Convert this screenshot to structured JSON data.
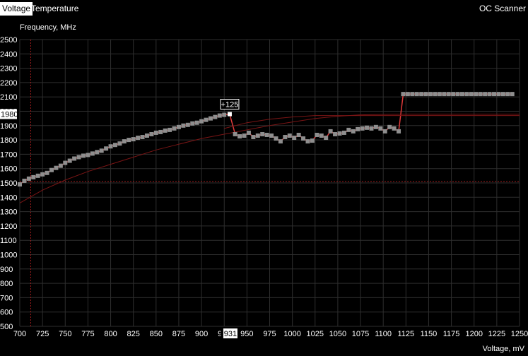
{
  "tabs": [
    {
      "label": "Voltage",
      "active": true
    },
    {
      "label": "Temperature",
      "active": false
    }
  ],
  "oc_scanner_label": "OC Scanner",
  "chart_data": {
    "type": "line",
    "ylabel": "Frequency, MHz",
    "xlabel": "Voltage, mV",
    "xlim": [
      700,
      1250
    ],
    "ylim": [
      500,
      2500
    ],
    "x_ticks": [
      700,
      725,
      750,
      775,
      800,
      825,
      850,
      875,
      900,
      925,
      950,
      975,
      1000,
      1025,
      1050,
      1075,
      1100,
      1125,
      1150,
      1175,
      1200,
      1225,
      1250
    ],
    "y_ticks": [
      500,
      600,
      700,
      800,
      900,
      1000,
      1100,
      1200,
      1300,
      1400,
      1500,
      1600,
      1700,
      1800,
      1900,
      2000,
      2100,
      2200,
      2300,
      2400,
      2500
    ],
    "grid": true,
    "colors": {
      "curve": "#e03a3a",
      "point": "#8e8e8e",
      "selected_point": "#ffffff",
      "default_curve": "#7a1515",
      "reference": "#a01c1c",
      "grid": "#2e2e2e"
    },
    "selected": {
      "x": 931,
      "y": 1980,
      "offset_label": "+125",
      "x_label": "931",
      "y_label": "1980"
    },
    "reference_lines": {
      "vertical_x": 712,
      "horizontal_y": 1510
    },
    "series": [
      {
        "role": "curve",
        "x": [
          700,
          705,
          710,
          715,
          720,
          725,
          730,
          735,
          740,
          745,
          750,
          755,
          760,
          765,
          770,
          775,
          780,
          785,
          790,
          795,
          800,
          805,
          810,
          815,
          820,
          825,
          830,
          835,
          840,
          845,
          850,
          855,
          860,
          865,
          870,
          875,
          880,
          885,
          890,
          895,
          900,
          905,
          910,
          915,
          920,
          925,
          931,
          937,
          942,
          947,
          952,
          957,
          962,
          967,
          972,
          977,
          982,
          987,
          992,
          997,
          1002,
          1007,
          1012,
          1017,
          1022,
          1027,
          1032,
          1037,
          1042,
          1047,
          1052,
          1057,
          1062,
          1067,
          1072,
          1077,
          1082,
          1087,
          1092,
          1097,
          1102,
          1107,
          1112,
          1117,
          1122,
          1127,
          1132,
          1137,
          1142,
          1147,
          1152,
          1157,
          1162,
          1167,
          1172,
          1177,
          1182,
          1187,
          1192,
          1197,
          1202,
          1207,
          1212,
          1217,
          1222,
          1227,
          1232,
          1237,
          1242
        ],
        "y": [
          1490,
          1515,
          1530,
          1540,
          1550,
          1560,
          1570,
          1590,
          1605,
          1620,
          1640,
          1655,
          1670,
          1680,
          1690,
          1695,
          1705,
          1715,
          1725,
          1740,
          1755,
          1765,
          1775,
          1790,
          1800,
          1805,
          1815,
          1820,
          1830,
          1840,
          1850,
          1855,
          1865,
          1870,
          1880,
          1890,
          1900,
          1905,
          1915,
          1920,
          1930,
          1940,
          1950,
          1960,
          1970,
          1975,
          1980,
          1840,
          1825,
          1830,
          1850,
          1820,
          1830,
          1840,
          1835,
          1830,
          1810,
          1790,
          1820,
          1830,
          1815,
          1835,
          1810,
          1790,
          1795,
          1835,
          1830,
          1815,
          1860,
          1840,
          1845,
          1850,
          1870,
          1860,
          1875,
          1880,
          1885,
          1880,
          1890,
          1880,
          1860,
          1890,
          1880,
          1860,
          2120,
          2120,
          2120,
          2120,
          2120,
          2120,
          2120,
          2120,
          2120,
          2120,
          2120,
          2120,
          2120,
          2120,
          2120,
          2120,
          2120,
          2120,
          2120,
          2120,
          2120,
          2120,
          2120,
          2120,
          2120
        ]
      },
      {
        "role": "default",
        "x": [
          700,
          725,
          750,
          775,
          800,
          825,
          850,
          875,
          900,
          925,
          950,
          975,
          1000,
          1025,
          1050,
          1075,
          1100,
          1125,
          1150,
          1250
        ],
        "y": [
          1360,
          1450,
          1520,
          1580,
          1630,
          1680,
          1730,
          1770,
          1810,
          1840,
          1870,
          1900,
          1925,
          1950,
          1965,
          1975,
          1978,
          1980,
          1980,
          1980
        ]
      },
      {
        "role": "offset-reference",
        "x": [
          925,
          950,
          975,
          1000,
          1025,
          1050,
          1075,
          1100,
          1125,
          1150,
          1175,
          1200,
          1225,
          1250
        ],
        "y": [
          1880,
          1920,
          1945,
          1960,
          1970,
          1970,
          1970,
          1970,
          1970,
          1970,
          1970,
          1970,
          1970,
          1970
        ]
      }
    ]
  }
}
